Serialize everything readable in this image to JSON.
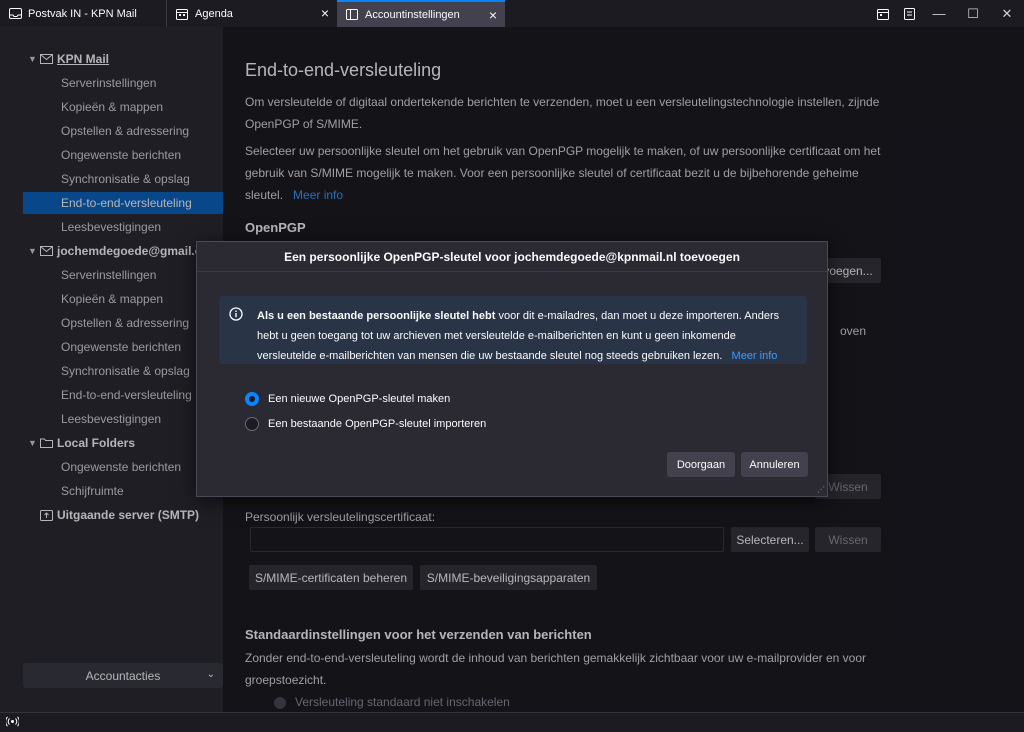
{
  "tabs": [
    {
      "label": "Postvak IN - KPN Mail",
      "icon": "mail-icon"
    },
    {
      "label": "Agenda",
      "icon": "calendar-icon"
    },
    {
      "label": "Accountinstellingen",
      "icon": "settings-page-icon"
    }
  ],
  "sidebar": {
    "accounts": [
      {
        "name": "KPN Mail",
        "items": [
          "Serverinstellingen",
          "Kopieën & mappen",
          "Opstellen & adressering",
          "Ongewenste berichten",
          "Synchronisatie & opslag",
          "End-to-end-versleuteling",
          "Leesbevestigingen"
        ],
        "selected_index": 5
      },
      {
        "name": "jochemdegoede@gmail.com",
        "items": [
          "Serverinstellingen",
          "Kopieën & mappen",
          "Opstellen & adressering",
          "Ongewenste berichten",
          "Synchronisatie & opslag",
          "End-to-end-versleuteling",
          "Leesbevestigingen"
        ]
      },
      {
        "name": "Local Folders",
        "items": [
          "Ongewenste berichten",
          "Schijfruimte"
        ]
      },
      {
        "name": "Uitgaande server (SMTP)",
        "items": []
      }
    ],
    "account_actions": "Accountacties"
  },
  "main": {
    "title": "End-to-end-versleuteling",
    "intro": "Om versleutelde of digitaal ondertekende berichten te verzenden, moet u een versleutelingstechnologie instellen, zijnde OpenPGP of S/MIME.",
    "select_text": "Selecteer uw persoonlijke sleutel om het gebruik van OpenPGP mogelijk te maken, of uw persoonlijke certificaat om het gebruik van S/MIME mogelijk te maken. Voor een persoonlijke sleutel of certificaat bezit u de bijbehorende geheime sleutel.",
    "more_info": "Meer info",
    "openpgp_heading": "OpenPGP",
    "add_key_btn": "voegen...",
    "partial_right": "oven",
    "clear_btn": "Wissen",
    "smime_label": "Persoonlijk versleutelingscertificaat:",
    "select_btn": "Selecteren...",
    "clear_btn2": "Wissen",
    "manage_certs_btn": "S/MIME-certificaten beheren",
    "security_devices_btn": "S/MIME-beveiligingsapparaten",
    "defaults_heading": "Standaardinstellingen voor het verzenden van berichten",
    "defaults_text": "Zonder end-to-end-versleuteling wordt de inhoud van berichten gemakkelijk zichtbaar voor uw e-mailprovider en voor groepstoezicht.",
    "radio_no_encrypt": "Versleuteling standaard niet inschakelen"
  },
  "dialog": {
    "title": "Een persoonlijke OpenPGP-sleutel voor jochemdegoede@kpnmail.nl toevoegen",
    "info_bold": "Als u een bestaande persoonlijke sleutel hebt",
    "info_text": " voor dit e-mailadres, dan moet u deze importeren. Anders hebt u geen toegang tot uw archieven met versleutelde e-mailberichten en kunt u geen inkomende versleutelde e-mailberichten van mensen die uw bestaande sleutel nog steeds gebruiken lezen.",
    "info_link": "Meer info",
    "option_new": "Een nieuwe OpenPGP-sleutel maken",
    "option_import": "Een bestaande OpenPGP-sleutel importeren",
    "continue_btn": "Doorgaan",
    "cancel_btn": "Annuleren"
  },
  "colors": {
    "accent": "#0a84ff",
    "selected": "#0b63c0",
    "link": "#3c9bff"
  }
}
